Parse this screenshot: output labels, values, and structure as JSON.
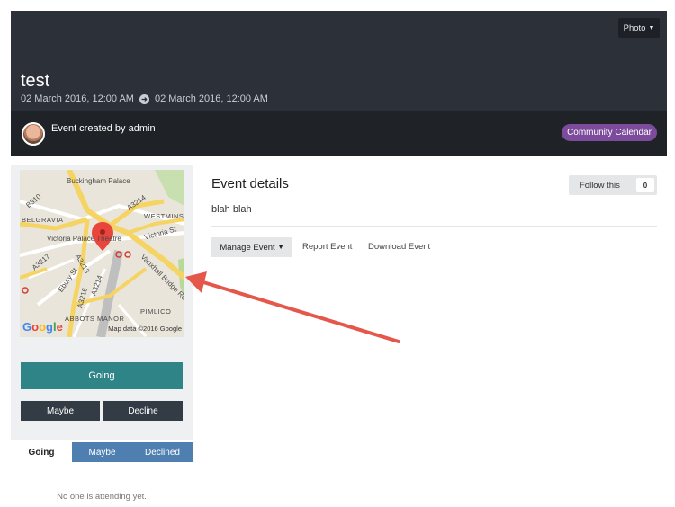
{
  "cover": {
    "photo_button": "Photo",
    "title": "test",
    "start_date": "02 March 2016, 12:00 AM",
    "end_date": "02 March 2016, 12:00 AM"
  },
  "author": {
    "text": "Event created by admin",
    "calendar_badge": "Community Calendar"
  },
  "map": {
    "labels": {
      "buckingham": "Buckingham Palace",
      "a3214_top": "A3214",
      "b310": "B310",
      "belgravia": "BELGRAVIA",
      "westminster": "WESTMINST",
      "victoria_palace": "Victoria Palace Theatre",
      "victoria_st": "Victoria St",
      "a3217": "A3217",
      "a3213": "A3213",
      "a3214_mid": "A3214",
      "ebury_st": "Ebury St",
      "a3216": "A3216",
      "vauxhall": "Vauxhall Bridge Rd",
      "pimlico": "PIMLICO",
      "abbots_manor": "ABBOTS MANOR"
    },
    "google_logo": "Google",
    "attribution": "Map data ©2016 Google"
  },
  "rsvp": {
    "going_label": "Going",
    "maybe_label": "Maybe",
    "decline_label": "Decline"
  },
  "attendee_tabs": {
    "going": "Going",
    "maybe": "Maybe",
    "declined": "Declined",
    "empty_message": "No one is attending yet."
  },
  "details": {
    "title": "Event details",
    "body": "blah blah",
    "follow_label": "Follow this",
    "follow_count": "0"
  },
  "actions": {
    "manage_label": "Manage Event",
    "report_label": "Report Event",
    "download_label": "Download Event"
  },
  "colors": {
    "cover_bg": "#2b3039",
    "author_bar_bg": "#1f2226",
    "badge_purple": "#7d4b9b",
    "going_teal": "#2e8487",
    "tab_blue": "#4e7fb0",
    "annotation_arrow": "#e6574b"
  }
}
